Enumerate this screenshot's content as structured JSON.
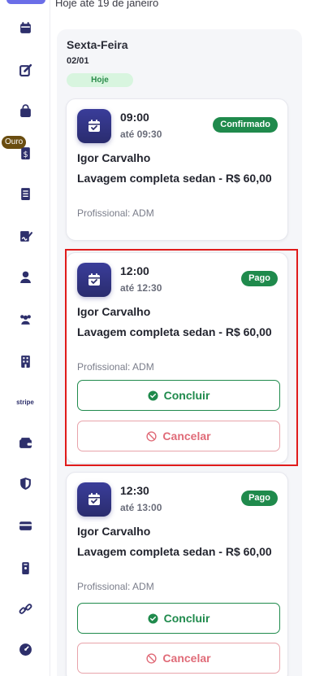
{
  "sidebar": {
    "items": [
      {
        "name": "calendar-icon"
      },
      {
        "name": "edit-icon"
      },
      {
        "name": "bag-icon"
      },
      {
        "name": "receipt-dollar-icon"
      },
      {
        "name": "document-list-icon"
      },
      {
        "name": "signature-icon"
      },
      {
        "name": "user-icon"
      },
      {
        "name": "team-icon"
      },
      {
        "name": "building-icon"
      },
      {
        "name": "stripe-icon",
        "text": "stripe"
      },
      {
        "name": "wallet-icon"
      },
      {
        "name": "shield-icon"
      },
      {
        "name": "credit-card-icon"
      },
      {
        "name": "badge-icon"
      },
      {
        "name": "link-icon"
      },
      {
        "name": "gauge-icon"
      }
    ],
    "ouro_badge": "Ouro"
  },
  "header": {
    "subtitle": "Hoje até 19 de janeiro"
  },
  "day": {
    "name": "Sexta-Feira",
    "date": "02/01",
    "today_label": "Hoje"
  },
  "appointments": [
    {
      "time": "09:00",
      "until": "até 09:30",
      "status": "Confirmado",
      "client": "Igor Carvalho",
      "service": "Lavagem completa sedan - R$ 60,00",
      "professional": "Profissional: ADM"
    },
    {
      "time": "12:00",
      "until": "até 12:30",
      "status": "Pago",
      "client": "Igor Carvalho",
      "service": "Lavagem completa sedan - R$ 60,00",
      "professional": "Profissional: ADM",
      "complete_label": "Concluir",
      "cancel_label": "Cancelar"
    },
    {
      "time": "12:30",
      "until": "até 13:00",
      "status": "Pago",
      "client": "Igor Carvalho",
      "service": "Lavagem completa sedan - R$ 60,00",
      "professional": "Profissional: ADM",
      "complete_label": "Concluir",
      "cancel_label": "Cancelar"
    }
  ],
  "colors": {
    "accent": "#2d2f6b",
    "success": "#1f8a4c",
    "danger": "#e06b78",
    "highlight": "#e01b1b"
  }
}
